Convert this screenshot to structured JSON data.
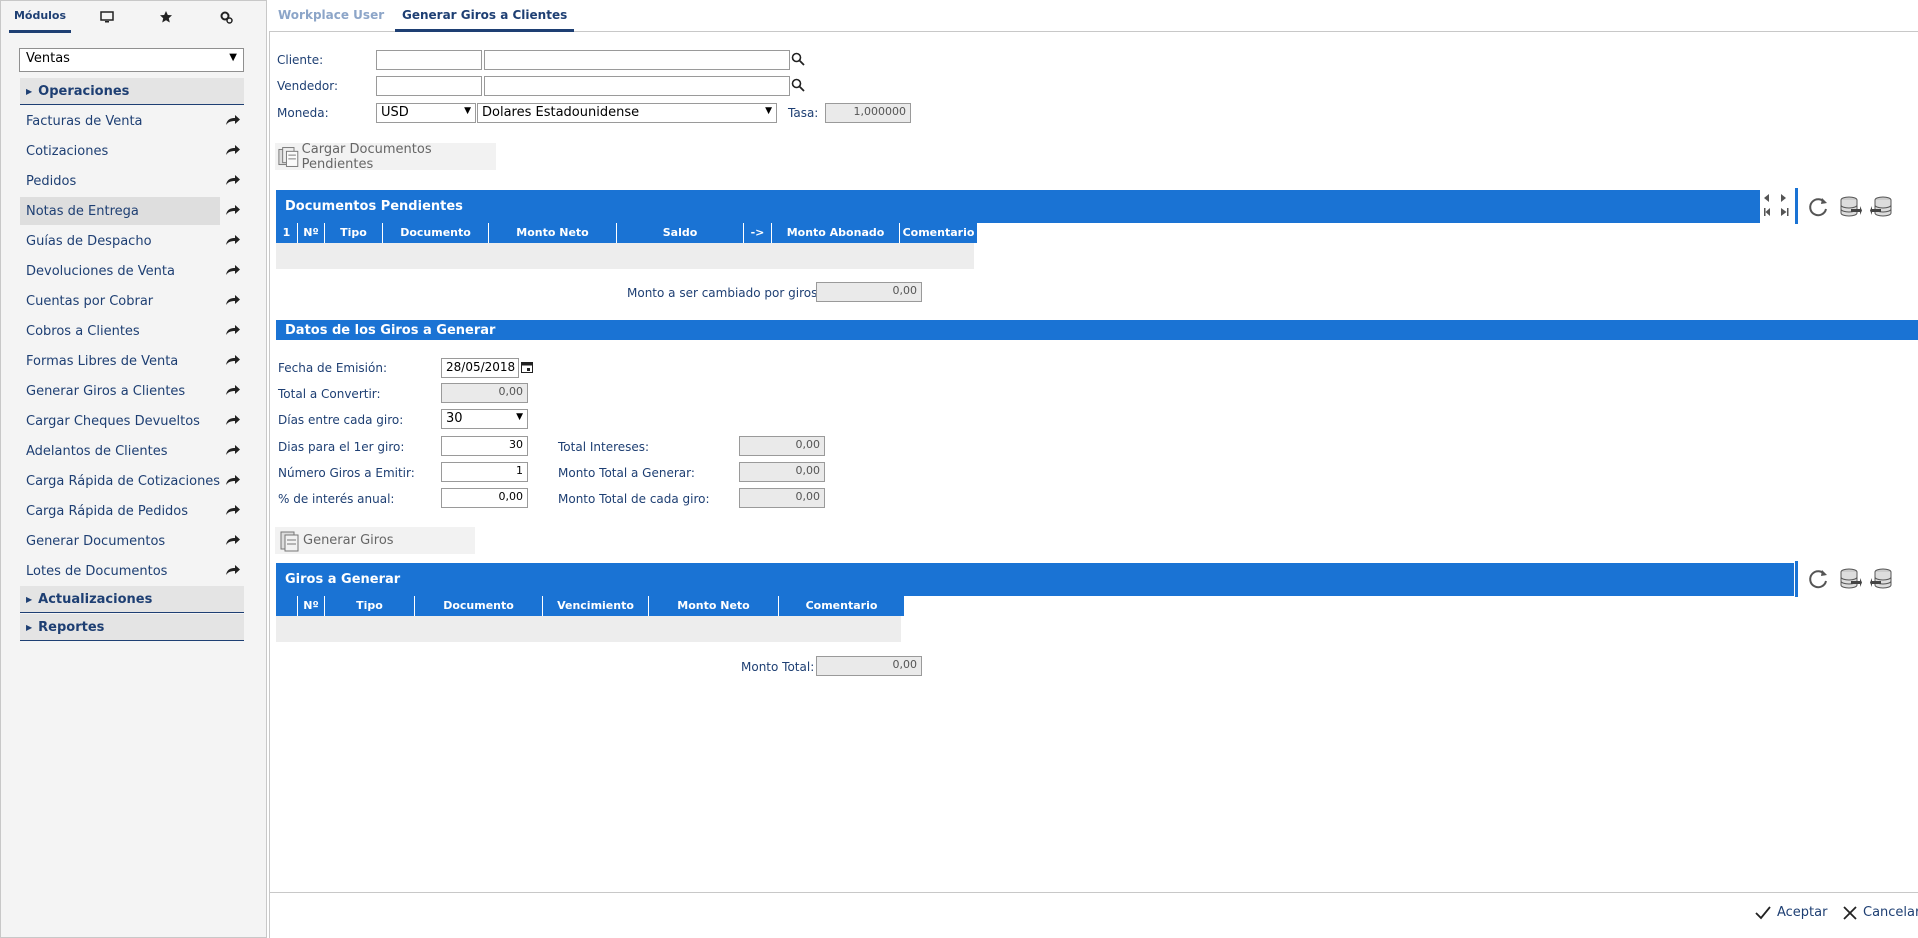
{
  "sidebar": {
    "tabs": {
      "modules_label": "Módulos",
      "monitor_icon": "monitor-icon",
      "star_icon": "star-icon",
      "settings_icon": "gear-icon"
    },
    "module_select": {
      "value": "Ventas"
    },
    "sections": [
      {
        "label": "Operaciones",
        "expanded": true
      },
      {
        "label": "Actualizaciones",
        "expanded": false
      },
      {
        "label": "Reportes",
        "expanded": false
      }
    ],
    "items": [
      {
        "label": "Facturas de Venta"
      },
      {
        "label": "Cotizaciones"
      },
      {
        "label": "Pedidos"
      },
      {
        "label": "Notas de Entrega"
      },
      {
        "label": "Guías de Despacho"
      },
      {
        "label": "Devoluciones de Venta"
      },
      {
        "label": "Cuentas por Cobrar"
      },
      {
        "label": "Cobros a Clientes"
      },
      {
        "label": "Formas Libres de Venta"
      },
      {
        "label": "Generar Giros a Clientes"
      },
      {
        "label": "Cargar Cheques Devueltos"
      },
      {
        "label": "Adelantos de Clientes"
      },
      {
        "label": "Carga Rápida de Cotizaciones"
      },
      {
        "label": "Carga Rápida de Pedidos"
      },
      {
        "label": "Generar Documentos"
      },
      {
        "label": "Lotes de Documentos"
      }
    ],
    "active_item": "Notas de Entrega"
  },
  "tabs": [
    {
      "label": "Workplace User",
      "active": false
    },
    {
      "label": "Generar Giros a Clientes",
      "active": true
    }
  ],
  "form": {
    "cliente_label": "Cliente:",
    "cliente_code": "",
    "cliente_name": "",
    "vendedor_label": "Vendedor:",
    "vendedor_code": "",
    "vendedor_name": "",
    "moneda_label": "Moneda:",
    "moneda_code": "USD",
    "moneda_name": "Dolares Estadounidense",
    "tasa_label": "Tasa:",
    "tasa_value": "1,000000"
  },
  "cargar_button": "Cargar Documentos Pendientes",
  "pendientes": {
    "title": "Documentos Pendientes",
    "columns": [
      "1",
      "Nº",
      "Tipo",
      "Documento",
      "Monto Neto",
      "Saldo",
      "->",
      "Monto Abonado",
      "Comentario"
    ],
    "monto_label": "Monto a ser cambiado por giros:",
    "monto_value": "0,00"
  },
  "datos": {
    "title": "Datos de los Giros a Generar",
    "fecha_label": "Fecha de Emisión:",
    "fecha_value": "28/05/2018",
    "total_convertir_label": "Total a Convertir:",
    "total_convertir_value": "0,00",
    "dias_entre_label": "Días entre cada giro:",
    "dias_entre_value": "30",
    "dias_primer_label": "Dias para el 1er giro:",
    "dias_primer_value": "30",
    "numero_label": "Número Giros a Emitir:",
    "numero_value": "1",
    "interes_label": "% de interés anual:",
    "interes_value": "0,00",
    "total_intereses_label": "Total Intereses:",
    "total_intereses_value": "0,00",
    "monto_total_generar_label": "Monto Total a Generar:",
    "monto_total_generar_value": "0,00",
    "monto_cada_label": "Monto Total de cada giro:",
    "monto_cada_value": "0,00"
  },
  "generar_button": "Generar Giros",
  "giros": {
    "title": "Giros a Generar",
    "columns": [
      "",
      "Nº",
      "Tipo",
      "Documento",
      "Vencimiento",
      "Monto Neto",
      "Comentario"
    ],
    "monto_total_label": "Monto Total:",
    "monto_total_value": "0,00"
  },
  "footer": {
    "accept_label": "Aceptar",
    "cancel_label": "Cancelar"
  },
  "colors": {
    "primary": "#1a73d4",
    "navy": "#1e3f73"
  }
}
